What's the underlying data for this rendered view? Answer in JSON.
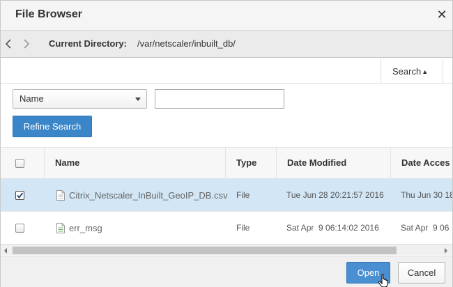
{
  "dialog": {
    "title": "File Browser"
  },
  "directory": {
    "label": "Current Directory:",
    "path": "/var/netscaler/inbuilt_db/"
  },
  "search_tab": {
    "label": "Search"
  },
  "filter": {
    "field": "Name",
    "value": ""
  },
  "refine_button": "Refine Search",
  "table": {
    "columns": [
      "Name",
      "Type",
      "Date Modified",
      "Date Acces"
    ],
    "rows": [
      {
        "name": "Citrix_Netscaler_InBuilt_GeoIP_DB.csv",
        "type": "File",
        "modified": "Tue Jun 28 20:21:57 2016",
        "accessed": "Thu Jun 30 18",
        "checked": true
      },
      {
        "name": "err_msg",
        "type": "File",
        "modified": "Sat Apr  9 06:14:02 2016",
        "accessed": "Sat Apr  9 06",
        "checked": false
      }
    ]
  },
  "footer": {
    "open": "Open",
    "cancel": "Cancel"
  },
  "colors": {
    "accent": "#3b86c9",
    "selected_row": "#d2e6f5"
  }
}
